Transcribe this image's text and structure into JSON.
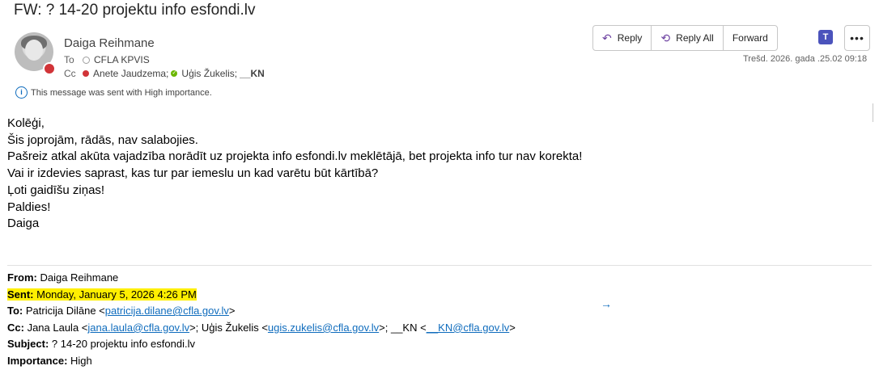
{
  "subject": "FW: ? 14-20 projektu info esfondi.lv",
  "sender": {
    "name": "Daiga Reihmane"
  },
  "to": {
    "label": "To",
    "recipient": "CFLA KPVIS"
  },
  "cc": {
    "label": "Cc",
    "recipient1": "Anete Jaudzema;",
    "recipient2": "Uģis Žukelis;",
    "recipient3": "__KN"
  },
  "importance_notice": "This message was sent with High importance.",
  "actions": {
    "reply": "Reply",
    "reply_all": "Reply All",
    "forward": "Forward",
    "more": "•••"
  },
  "date": "Trešd. 2026.  gada .25.02 09:18",
  "body_lines": [
    "Kolēģi,",
    "Šis joprojām, rādās, nav salabojies.",
    "Pašreiz atkal akūta vajadzība norādīt uz projekta info esfondi.lv meklētājā, bet projekta info tur nav korekta!",
    "Vai ir izdevies saprast, kas tur par iemeslu un kad varētu būt kārtībā?",
    "Ļoti gaidīšu ziņas!",
    "Paldies!",
    "Daiga"
  ],
  "forwarded": {
    "from_label": "From:",
    "from": " Daiga Reihmane",
    "sent_label": "Sent:",
    "sent": " Monday, January 5, 2026 4:26 PM",
    "to_label": "To:",
    "to_name": " Patricija Dilāne <",
    "to_email": "patricija.dilane@cfla.gov.lv",
    "to_end": ">",
    "cc_label": "Cc:",
    "cc_name1": " Jana Laula <",
    "cc_email1": "jana.laula@cfla.gov.lv",
    "cc_name2": ">; Uģis Žukelis <",
    "cc_email2": "ugis.zukelis@cfla.gov.lv",
    "cc_name3": ">; __KN <",
    "cc_email3": "__KN@cfla.gov.lv",
    "cc_end": ">",
    "subject_label": "Subject:",
    "subject": " ? 14-20 projektu info esfondi.lv",
    "importance_label": "Importance:",
    "importance": " High"
  }
}
